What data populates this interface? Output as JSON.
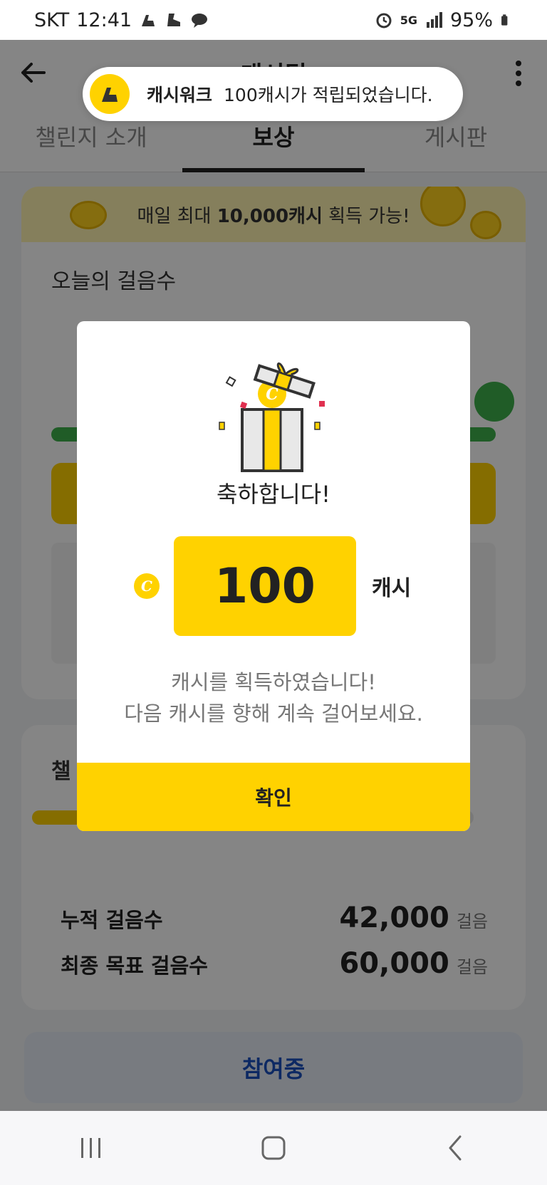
{
  "status_bar": {
    "carrier": "SKT",
    "time": "12:41",
    "network": "5G",
    "battery": "95%"
  },
  "header": {
    "title": "캐시딜"
  },
  "tabs": [
    {
      "label": "챌린지 소개"
    },
    {
      "label": "보상"
    },
    {
      "label": "게시판"
    }
  ],
  "banner": {
    "prefix": "매일 최대",
    "highlight": "10,000캐시",
    "suffix": "획득 가능!"
  },
  "today_card": {
    "title": "오늘의 걸음수"
  },
  "challenge_card": {
    "title": "챌",
    "progress": 0.7,
    "stats": [
      {
        "label": "누적 걸음수",
        "value": "42,000",
        "unit": "걸음"
      },
      {
        "label": "최종 목표 걸음수",
        "value": "60,000",
        "unit": "걸음"
      }
    ]
  },
  "join_button": {
    "label": "참여중"
  },
  "toast": {
    "app_name": "캐시워크",
    "message": "100캐시가 적립되었습니다."
  },
  "modal": {
    "title": "축하합니다!",
    "amount": "100",
    "unit": "캐시",
    "coin_glyph": "C",
    "desc_line1": "캐시를 획득하였습니다!",
    "desc_line2": "다음 캐시를 향해 계속 걸어보세요.",
    "confirm_label": "확인"
  },
  "colors": {
    "accent_yellow": "#ffd200",
    "green": "#3fb14c",
    "join_text": "#1a4fbf"
  }
}
